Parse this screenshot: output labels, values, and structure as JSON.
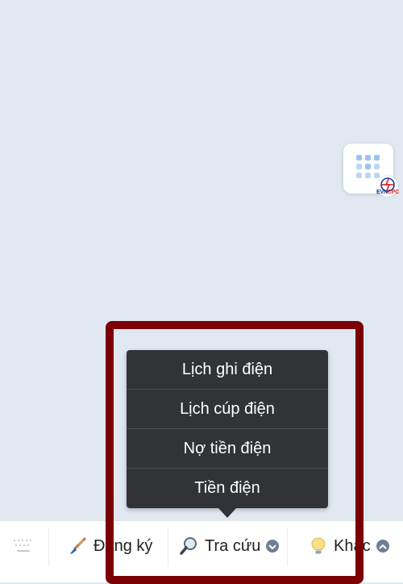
{
  "floating_widget": {
    "icon": "grid-icon",
    "brand": {
      "part1": "EVN",
      "part2": "CPC"
    }
  },
  "popup_menu": {
    "items": [
      {
        "label": "Lịch ghi điện"
      },
      {
        "label": "Lịch cúp điện"
      },
      {
        "label": "Nợ tiền điện"
      },
      {
        "label": "Tiền điện"
      }
    ]
  },
  "bottom_bar": {
    "keyboard_icon": "keyboard-icon",
    "tabs": [
      {
        "label": "Đang ký",
        "icon": "paintbrush-icon"
      },
      {
        "label": "Tra cứu",
        "icon": "magnifier-icon",
        "chevron": "chevron-down-icon"
      },
      {
        "label": "Khác",
        "icon": "lightbulb-icon",
        "chevron": "chevron-up-icon"
      }
    ]
  },
  "colors": {
    "background": "#e1e8f1",
    "menu": "#323336",
    "highlight": "#7b0006",
    "chevron": "#6e7f94"
  }
}
